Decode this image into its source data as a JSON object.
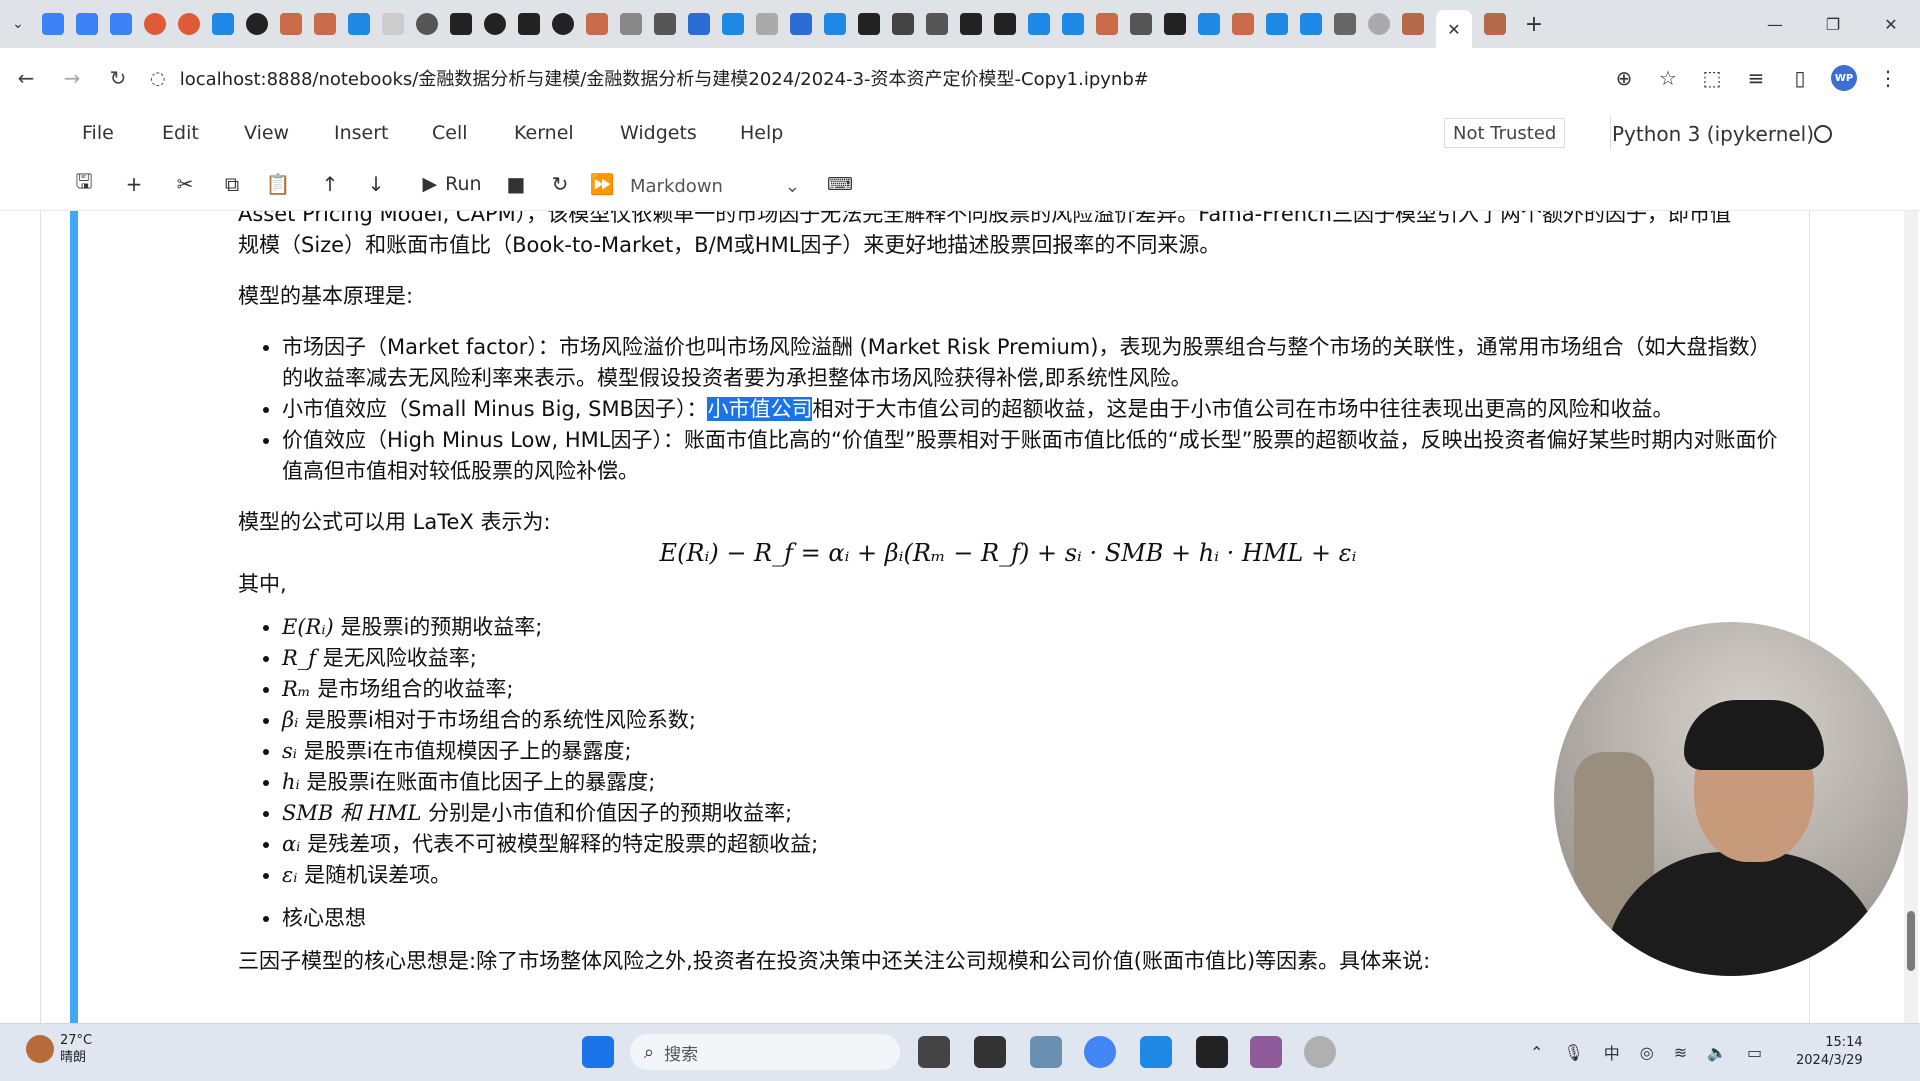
{
  "browser": {
    "active_tab_close": "✕",
    "new_tab": "+",
    "url": "localhost:8888/notebooks/金融数据分析与建模/金融数据分析与建模2024/2024-3-资本资产定价模型-Copy1.ipynb#",
    "profile_initials": "WP"
  },
  "menubar": {
    "items": [
      "File",
      "Edit",
      "View",
      "Insert",
      "Cell",
      "Kernel",
      "Widgets",
      "Help"
    ],
    "trusted": "Not Trusted",
    "kernel": "Python 3 (ipykernel)"
  },
  "toolbar": {
    "run_label": "Run",
    "cell_type": "Markdown"
  },
  "content": {
    "intro_line1": "Asset Pricing Model, CAPM），该模型仅依赖单一的市场因子无法完全解释不同股票的风险溢价差异。Fama-French三因子模型引入了两个额外的因子，即市值",
    "intro_line2": "规模（Size）和账面市值比（Book-to-Market，B/M或HML因子）来更好地描述股票回报率的不同来源。",
    "principle_heading": "模型的基本原理是:",
    "factor1": "市场因子（Market factor）：市场风险溢价也叫市场风险溢酬 (Market Risk Premium)，表现为股票组合与整个市场的关联性，通常用市场组合（如大盘指数）的收益率减去无风险利率来表示。模型假设投资者要为承担整体市场风险获得补偿,即系统性风险。",
    "factor2_pre": "小市值效应（Small Minus Big, SMB因子）：",
    "factor2_hl": "小市值公司",
    "factor2_post": "相对于大市值公司的超额收益，这是由于小市值公司在市场中往往表现出更高的风险和收益。",
    "factor3": "价值效应（High Minus Low, HML因子）：账面市值比高的“价值型”股票相对于账面市值比低的“成长型”股票的超额收益，反映出投资者偏好某些时期内对账面价值高但市值相对较低股票的风险补偿。",
    "latex_intro": "模型的公式可以用 LaTeX 表示为:",
    "formula": "E(Rᵢ) − R_f = αᵢ + βᵢ(Rₘ − R_f) + sᵢ · SMB + hᵢ · HML + εᵢ",
    "where": "其中,",
    "defs": [
      {
        "sym": "E(Rᵢ)",
        "text": " 是股票i的预期收益率;"
      },
      {
        "sym": "R_f",
        "text": " 是无风险收益率;"
      },
      {
        "sym": "Rₘ",
        "text": " 是市场组合的收益率;"
      },
      {
        "sym": "βᵢ",
        "text": " 是股票i相对于市场组合的系统性风险系数;"
      },
      {
        "sym": "sᵢ",
        "text": " 是股票i在市值规模因子上的暴露度;"
      },
      {
        "sym": "hᵢ",
        "text": " 是股票i在账面市值比因子上的暴露度;"
      },
      {
        "sym": "SMB 和 HML",
        "text": " 分别是小市值和价值因子的预期收益率;"
      },
      {
        "sym": "αᵢ",
        "text": " 是残差项，代表不可被模型解释的特定股票的超额收益;"
      },
      {
        "sym": "εᵢ",
        "text": " 是随机误差项。"
      }
    ],
    "core_bullet": "核心思想",
    "core_text": "三因子模型的核心思想是:除了市场整体风险之外,投资者在投资决策中还关注公司规模和公司价值(账面市值比)等因素。具体来说:"
  },
  "taskbar": {
    "weather_temp": "27°C",
    "weather_desc": "晴朗",
    "search_placeholder": "搜索",
    "time": "15:14",
    "date": "2024/3/29"
  },
  "colors": {
    "cell_bar": "#42a5f5",
    "highlight": "#1a73e8"
  }
}
